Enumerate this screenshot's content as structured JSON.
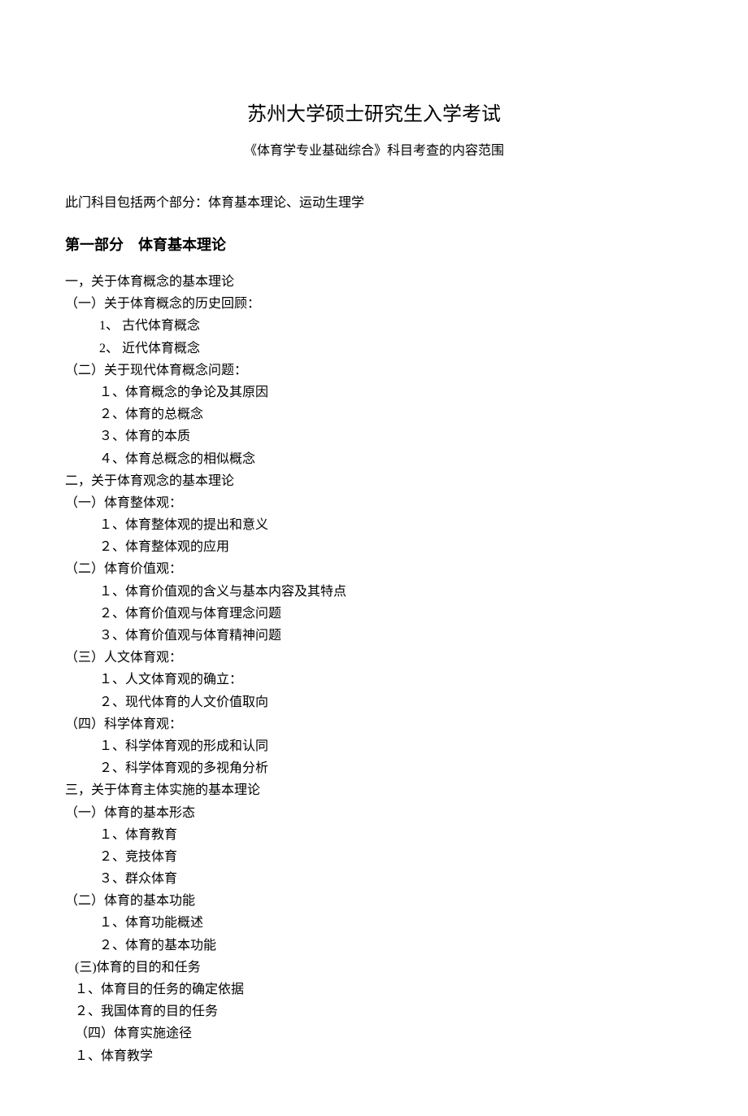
{
  "title": "苏州大学硕士研究生入学考试",
  "subtitle": "《体育学专业基础综合》科目考查的内容范围",
  "intro": "此门科目包括两个部分：体育基本理论、运动生理学",
  "part1": {
    "heading": "第一部分　体育基本理论",
    "sections": [
      {
        "heading": "一，关于体育概念的基本理论",
        "subs": [
          {
            "heading": "（一）关于体育概念的历史回顾：",
            "items": [
              "1、 古代体育概念",
              "2、 近代体育概念"
            ]
          },
          {
            "heading": "（二）关于现代体育概念问题：",
            "items": [
              "１、体育概念的争论及其原因",
              "２、体育的总概念",
              "３、体育的本质",
              "４、体育总概念的相似概念"
            ]
          }
        ]
      },
      {
        "heading": "二，关于体育观念的基本理论",
        "subs": [
          {
            "heading": "（一）体育整体观：",
            "items": [
              "１、体育整体观的提出和意义",
              "２、体育整体观的应用"
            ]
          },
          {
            "heading": "（二）体育价值观：",
            "items": [
              "１、体育价值观的含义与基本内容及其特点",
              "２、体育价值观与体育理念问题",
              "３、体育价值观与体育精神问题"
            ]
          },
          {
            "heading": "（三）人文体育观：",
            "items": [
              "１、人文体育观的确立：",
              "２、现代体育的人文价值取向"
            ]
          },
          {
            "heading": "（四）科学体育观：",
            "items": [
              "１、科学体育观的形成和认同",
              "２、科学体育观的多视角分析"
            ]
          }
        ]
      },
      {
        "heading": "三，关于体育主体实施的基本理论",
        "subs": [
          {
            "heading": "（一）体育的基本形态",
            "items": [
              "１、体育教育",
              "２、竞技体育",
              "３、群众体育"
            ]
          },
          {
            "heading": "（二）体育的基本功能",
            "items": [
              "１、体育功能概述",
              "２、体育的基本功能"
            ]
          },
          {
            "heading_alt": " (三)体育的目的和任务",
            "items_alt": [
              "１、体育目的任务的确定依据",
              "２、我国体育的目的任务"
            ]
          },
          {
            "heading_alt2": "（四）体育实施途径",
            "items_alt": [
              "１、体育教学"
            ]
          }
        ]
      }
    ]
  }
}
